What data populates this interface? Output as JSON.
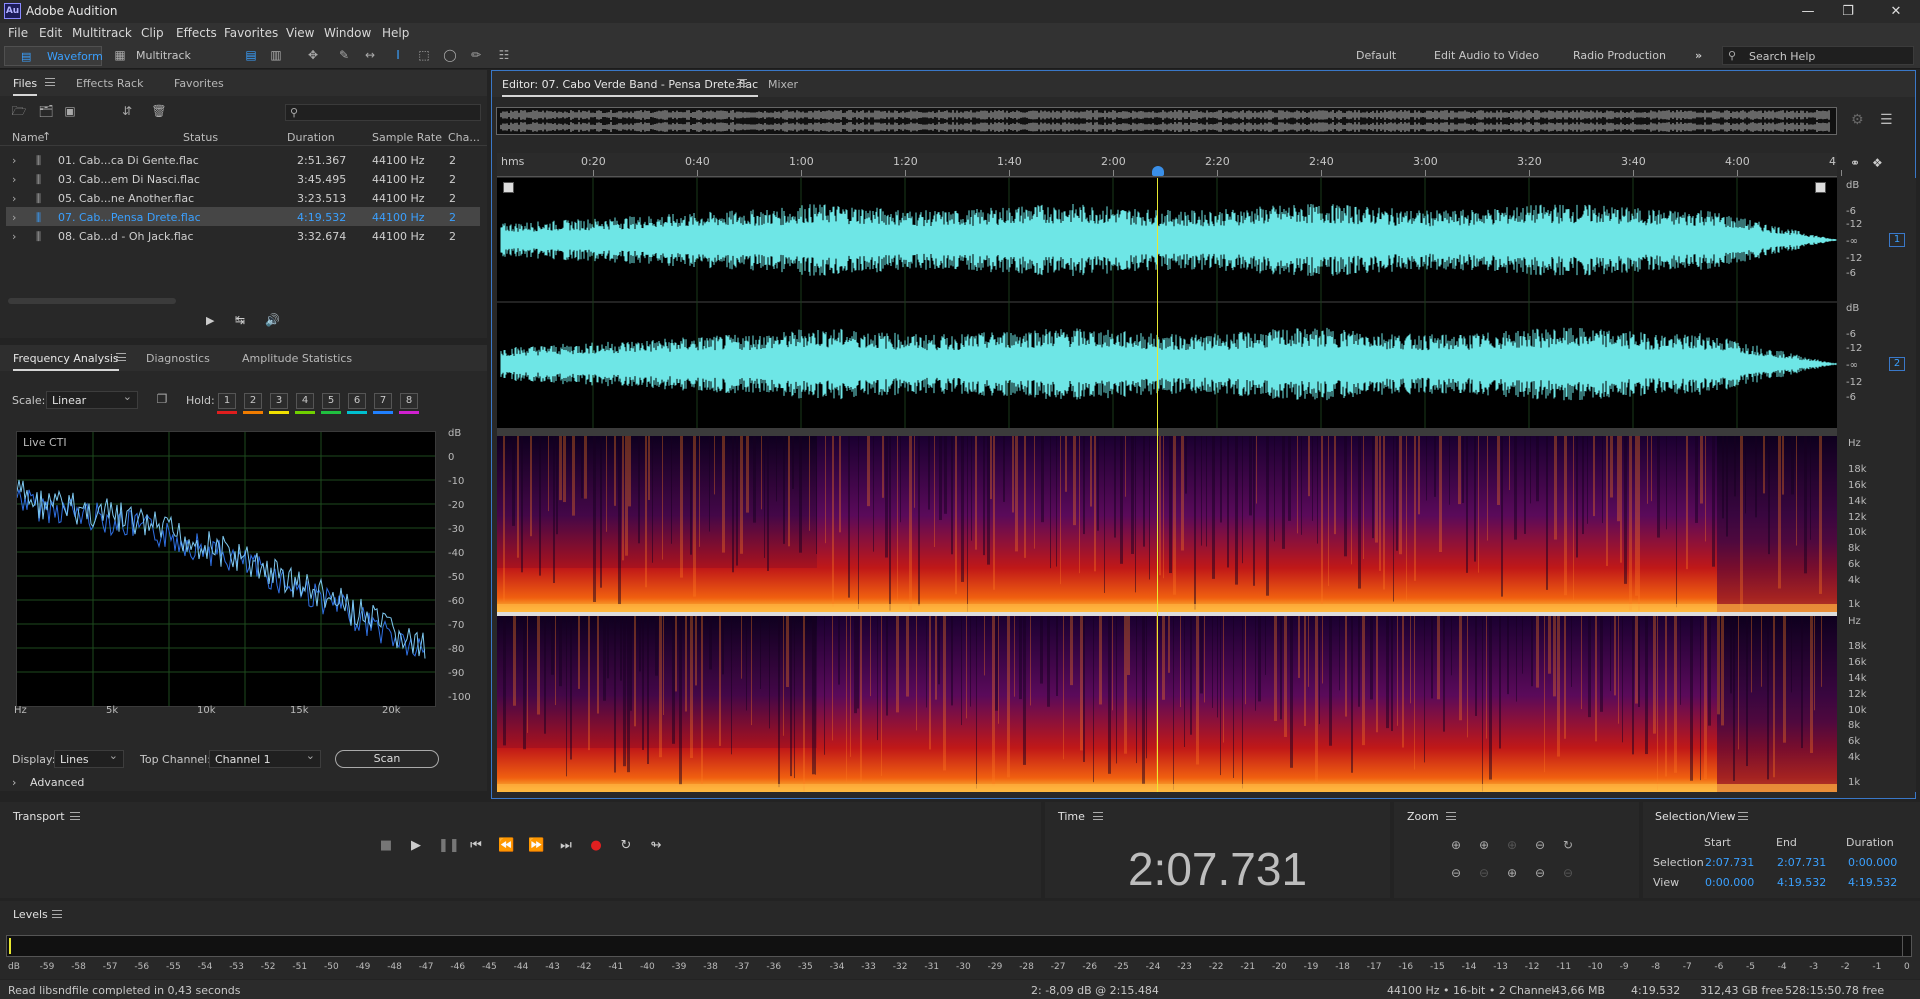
{
  "app": {
    "title": "Adobe Audition",
    "logo": "Au"
  },
  "menu": [
    "File",
    "Edit",
    "Multitrack",
    "Clip",
    "Effects",
    "Favorites",
    "View",
    "Window",
    "Help"
  ],
  "toolbar": {
    "waveform_label": "Waveform",
    "multitrack_label": "Multitrack",
    "workspaces": [
      "Default",
      "Edit Audio to Video",
      "Radio Production"
    ],
    "search_placeholder": "Search Help"
  },
  "files_panel": {
    "tabs": [
      "Files",
      "Effects Rack",
      "Favorites"
    ],
    "columns": [
      "Name",
      "Status",
      "Duration",
      "Sample Rate",
      "Cha..."
    ],
    "rows": [
      {
        "name": "01. Cab...ca Di Gente.flac",
        "duration": "2:51.367",
        "rate": "44100 Hz",
        "ch": "2",
        "selected": false
      },
      {
        "name": "03. Cab...em Di Nasci.flac",
        "duration": "3:45.495",
        "rate": "44100 Hz",
        "ch": "2",
        "selected": false
      },
      {
        "name": "05. Cab...ne Another.flac",
        "duration": "3:23.513",
        "rate": "44100 Hz",
        "ch": "2",
        "selected": false
      },
      {
        "name": "07. Cab...Pensa Drete.flac",
        "duration": "4:19.532",
        "rate": "44100 Hz",
        "ch": "2",
        "selected": true
      },
      {
        "name": "08. Cab...d - Oh Jack.flac",
        "duration": "3:32.674",
        "rate": "44100 Hz",
        "ch": "2",
        "selected": false
      }
    ]
  },
  "freq_panel": {
    "tabs": [
      "Frequency Analysis",
      "Diagnostics",
      "Amplitude Statistics"
    ],
    "scale_label": "Scale:",
    "scale_value": "Linear",
    "hold_label": "Hold:",
    "hold_buttons": [
      "1",
      "2",
      "3",
      "4",
      "5",
      "6",
      "7",
      "8"
    ],
    "hold_colors": [
      "#e01e1e",
      "#f07c00",
      "#f0e000",
      "#70d000",
      "#20c040",
      "#00c0d0",
      "#2080ff",
      "#d020d0"
    ],
    "live_label": "Live CTI",
    "db_ticks": [
      "dB",
      "0",
      "-10",
      "-20",
      "-30",
      "-40",
      "-50",
      "-60",
      "-70",
      "-80",
      "-90",
      "-100"
    ],
    "hz_ticks": [
      "Hz",
      "5k",
      "10k",
      "15k",
      "20k"
    ],
    "display_label": "Display:",
    "display_value": "Lines",
    "top_channel_label": "Top Channel:",
    "top_channel_value": "Channel 1",
    "scan_label": "Scan",
    "advanced_label": "Advanced"
  },
  "editor": {
    "tab_label": "Editor: 07. Cabo Verde Band - Pensa Drete.flac",
    "mixer_label": "Mixer",
    "ruler_unit": "hms",
    "ruler": [
      "0:20",
      "0:40",
      "1:00",
      "1:20",
      "1:40",
      "2:00",
      "2:20",
      "2:40",
      "3:00",
      "3:20",
      "3:40",
      "4:00",
      "4"
    ],
    "db_scale": [
      "dB",
      "-6",
      "-12",
      "-∞",
      "-12",
      "-6"
    ],
    "hz_scale": [
      "Hz",
      "18k",
      "16k",
      "14k",
      "12k",
      "10k",
      "8k",
      "6k",
      "4k",
      "1k"
    ],
    "channel_badges": [
      "1",
      "2"
    ]
  },
  "transport": {
    "title": "Transport"
  },
  "time_panel": {
    "title": "Time",
    "value": "2:07.731"
  },
  "zoom_panel": {
    "title": "Zoom"
  },
  "selection_panel": {
    "title": "Selection/View",
    "headers": [
      "Start",
      "End",
      "Duration"
    ],
    "selection": {
      "label": "Selection",
      "start": "2:07.731",
      "end": "2:07.731",
      "duration": "0:00.000"
    },
    "view": {
      "label": "View",
      "start": "0:00.000",
      "end": "4:19.532",
      "duration": "4:19.532"
    }
  },
  "levels": {
    "title": "Levels",
    "scale": [
      "dB",
      "-59",
      "-58",
      "-57",
      "-56",
      "-55",
      "-54",
      "-53",
      "-52",
      "-51",
      "-50",
      "-49",
      "-48",
      "-47",
      "-46",
      "-45",
      "-44",
      "-43",
      "-42",
      "-41",
      "-40",
      "-39",
      "-38",
      "-37",
      "-36",
      "-35",
      "-34",
      "-33",
      "-32",
      "-31",
      "-30",
      "-29",
      "-28",
      "-27",
      "-26",
      "-25",
      "-24",
      "-23",
      "-22",
      "-21",
      "-20",
      "-19",
      "-18",
      "-17",
      "-16",
      "-15",
      "-14",
      "-13",
      "-12",
      "-11",
      "-10",
      "-9",
      "-8",
      "-7",
      "-6",
      "-5",
      "-4",
      "-3",
      "-2",
      "-1",
      "0"
    ]
  },
  "status": {
    "message": "Read libsndfile completed in 0,43 seconds",
    "cursor_info": "2: -8,09 dB @ 2:15.484",
    "format": "44100 Hz • 16-bit • 2 Channel",
    "size": "43,66 MB",
    "duration": "4:19.532",
    "free": "312,43 GB free",
    "free_time": "528:15:50.78 free"
  },
  "colors": {
    "waveform": "#6ee6e6",
    "accent": "#3aa0ff",
    "playhead": "#e8e830"
  }
}
